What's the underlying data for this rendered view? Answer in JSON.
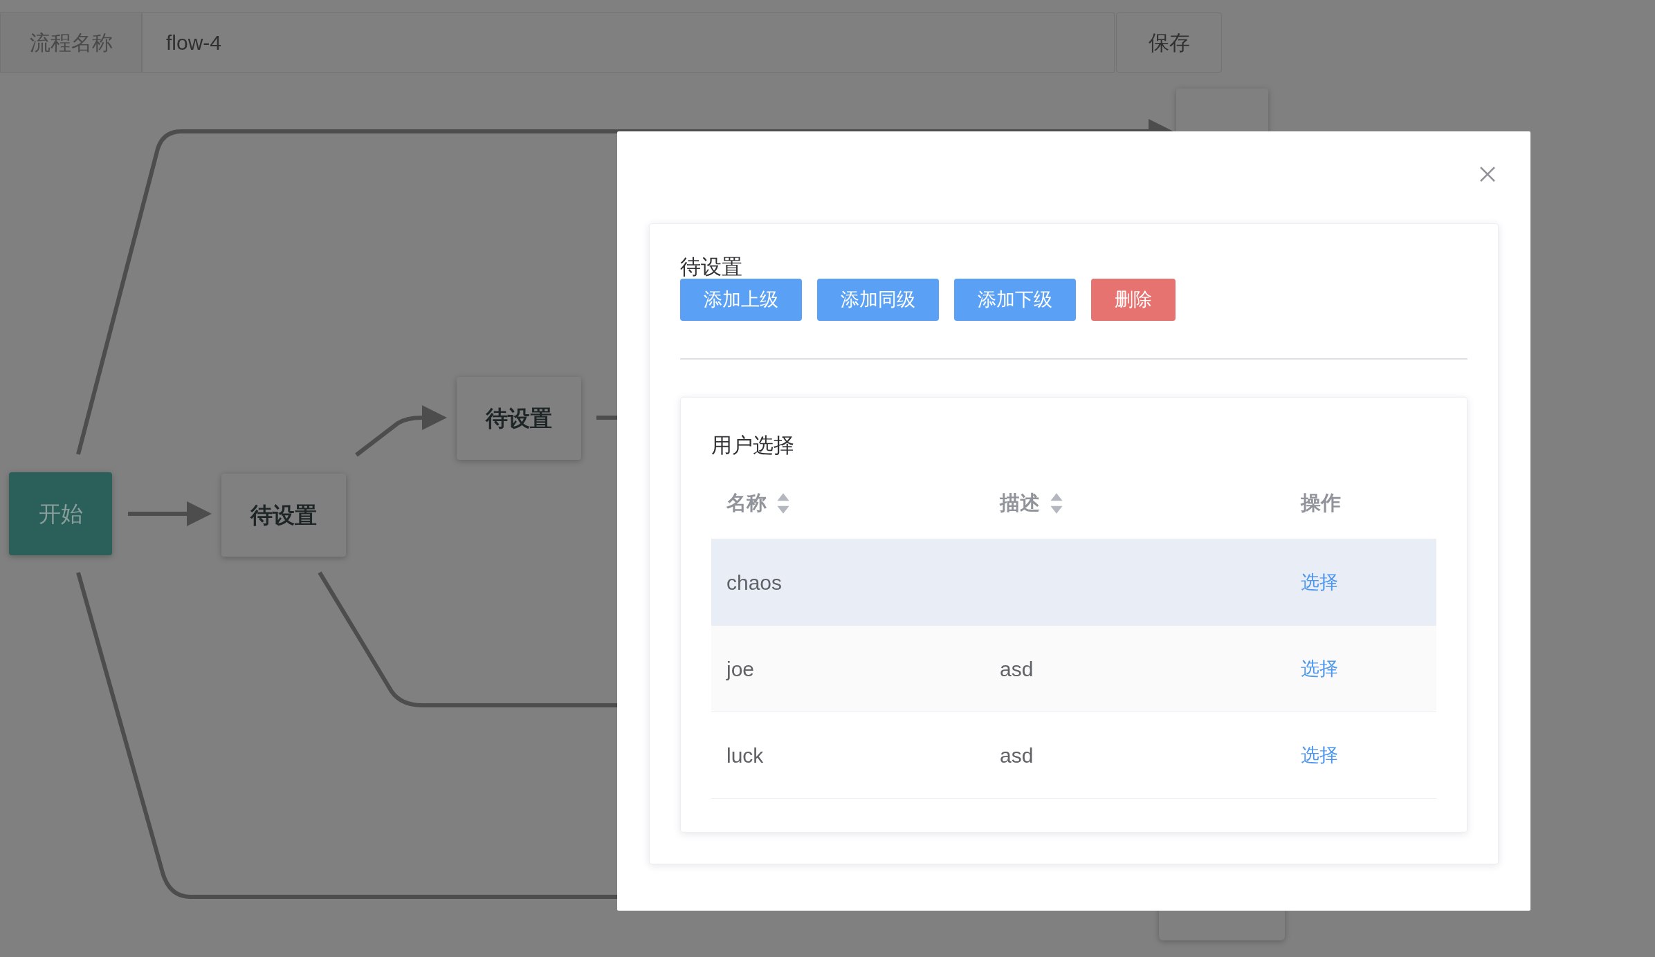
{
  "toolbar": {
    "label": "流程名称",
    "flow_name": "flow-4",
    "save_button": "保存"
  },
  "flow": {
    "nodes": [
      {
        "label": "开始",
        "kind": "start"
      },
      {
        "label": "待设置",
        "kind": "task"
      },
      {
        "label": "待设置",
        "kind": "task"
      }
    ]
  },
  "dialog": {
    "node_title": "待设置",
    "actions": [
      {
        "label": "添加上级",
        "kind": "primary"
      },
      {
        "label": "添加同级",
        "kind": "primary"
      },
      {
        "label": "添加下级",
        "kind": "primary"
      },
      {
        "label": "删除",
        "kind": "danger"
      }
    ],
    "user_panel": {
      "title": "用户选择",
      "columns": [
        {
          "label": "名称",
          "sortable": true
        },
        {
          "label": "描述",
          "sortable": true
        },
        {
          "label": "操作",
          "sortable": false
        }
      ],
      "rows": [
        {
          "name": "chaos",
          "action": "选择",
          "hovered": true
        },
        {
          "name": "joe",
          "description": "asd",
          "action": "选择",
          "hovered": false
        },
        {
          "name": "luck",
          "description": "asd",
          "action": "选择",
          "hovered": false
        }
      ]
    }
  }
}
